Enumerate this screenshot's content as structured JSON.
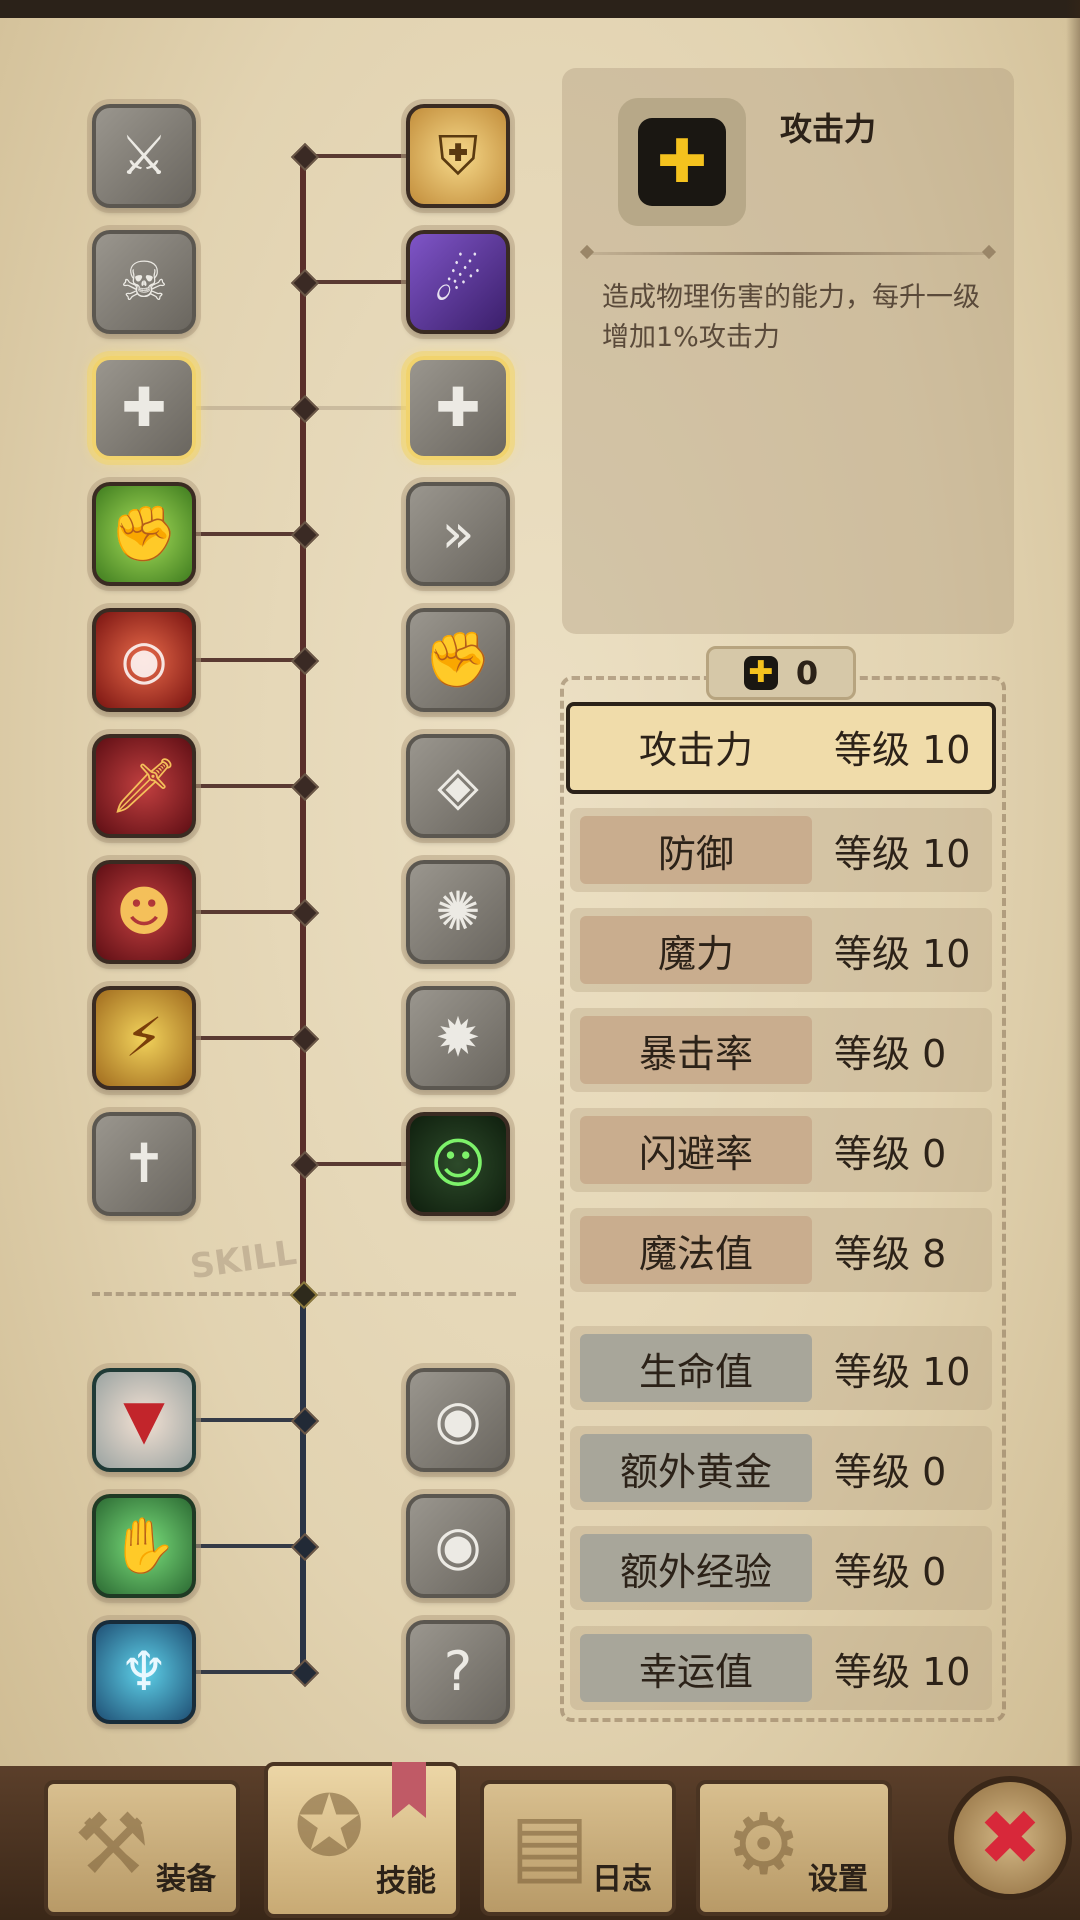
{
  "skill_tree": {
    "watermark": "SKILL",
    "left_column": [
      {
        "icon": "blade-slash-icon",
        "glyph": "⚔",
        "style": "gray"
      },
      {
        "icon": "leaping-kick-icon",
        "glyph": "☠",
        "style": "gray"
      },
      {
        "icon": "attack-plus-icon",
        "glyph": "✚",
        "style": "gray hover"
      },
      {
        "icon": "muscle-flex-icon",
        "glyph": "✊",
        "style": "green"
      },
      {
        "icon": "shadow-spin-icon",
        "glyph": "◉",
        "style": "red"
      },
      {
        "icon": "flaming-dagger-icon",
        "glyph": "🗡",
        "style": "crimson"
      },
      {
        "icon": "shadow-ninja-icon",
        "glyph": "☻",
        "style": "crimson"
      },
      {
        "icon": "lightning-warrior-icon",
        "glyph": "⚡",
        "style": "lightning"
      },
      {
        "icon": "broken-sword-icon",
        "glyph": "✝",
        "style": "gray"
      },
      {
        "icon": "trap-shrine-icon",
        "glyph": "▼",
        "style": "teal-red"
      },
      {
        "icon": "treasure-grab-icon",
        "glyph": "✋",
        "style": "teal-green"
      },
      {
        "icon": "lightning-aura-icon",
        "glyph": "♆",
        "style": "teal-blue"
      }
    ],
    "right_column": [
      {
        "icon": "holy-shield-icon",
        "glyph": "⛨",
        "style": "gold"
      },
      {
        "icon": "dark-strike-icon",
        "glyph": "☄",
        "style": "purple"
      },
      {
        "icon": "magic-plus-icon",
        "glyph": "✚",
        "style": "gray hover"
      },
      {
        "icon": "dash-icon",
        "glyph": "»",
        "style": "gray"
      },
      {
        "icon": "rock-smash-icon",
        "glyph": "✊",
        "style": "gray"
      },
      {
        "icon": "radiant-eye-icon",
        "glyph": "◈",
        "style": "gray"
      },
      {
        "icon": "whirlwind-slash-icon",
        "glyph": "✺",
        "style": "gray"
      },
      {
        "icon": "vortex-icon",
        "glyph": "✹",
        "style": "gray"
      },
      {
        "icon": "healing-ghost-icon",
        "glyph": "☺",
        "style": "ghost"
      },
      {
        "icon": "eye-shrine-icon",
        "glyph": "◉",
        "style": "gray"
      },
      {
        "icon": "eye-chest-icon",
        "glyph": "◉",
        "style": "gray"
      },
      {
        "icon": "mystery-figure-icon",
        "glyph": "?",
        "style": "gray"
      }
    ]
  },
  "detail": {
    "title": "攻击力",
    "icon": "plus-icon",
    "description": "造成物理伤害的能力，每升一级增加1%攻击力"
  },
  "points": {
    "value": "0"
  },
  "stats": [
    {
      "name": "攻击力",
      "level": "等级 10",
      "group": "combat",
      "selected": true
    },
    {
      "name": "防御",
      "level": "等级 10",
      "group": "combat"
    },
    {
      "name": "魔力",
      "level": "等级 10",
      "group": "combat"
    },
    {
      "name": "暴击率",
      "level": "等级 0",
      "group": "combat"
    },
    {
      "name": "闪避率",
      "level": "等级 0",
      "group": "combat"
    },
    {
      "name": "魔法值",
      "level": "等级 8",
      "group": "combat"
    },
    {
      "name": "生命值",
      "level": "等级 10",
      "group": "bonus"
    },
    {
      "name": "额外黄金",
      "level": "等级 0",
      "group": "bonus"
    },
    {
      "name": "额外经验",
      "level": "等级 0",
      "group": "bonus"
    },
    {
      "name": "幸运值",
      "level": "等级 10",
      "group": "bonus"
    }
  ],
  "nav": {
    "tabs": [
      {
        "label": "装备",
        "icon": "equipment-icon",
        "glyph": "⚒"
      },
      {
        "label": "技能",
        "icon": "skills-icon",
        "glyph": "✪",
        "active": true
      },
      {
        "label": "日志",
        "icon": "journal-icon",
        "glyph": "▤"
      },
      {
        "label": "设置",
        "icon": "settings-icon",
        "glyph": "⚙"
      }
    ],
    "close_icon": "close-icon"
  }
}
